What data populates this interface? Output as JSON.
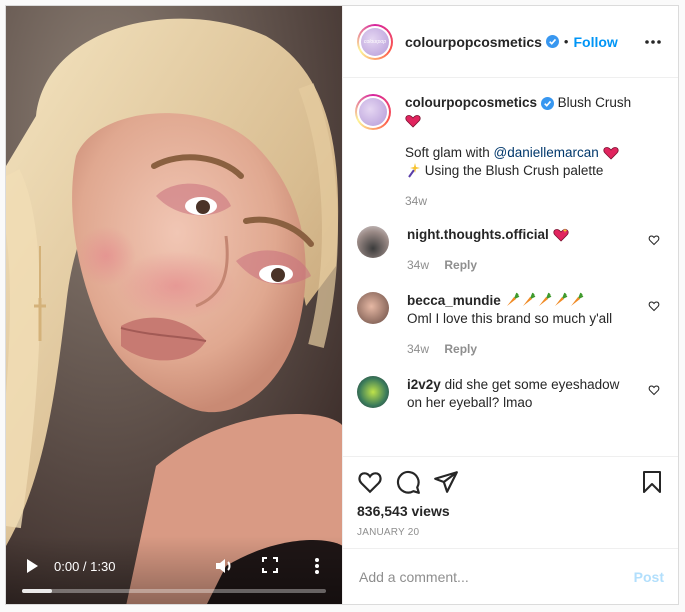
{
  "video": {
    "time_display": "0:00 / 1:30",
    "progress_fraction": 0.1
  },
  "header": {
    "username": "colourpopcosmetics",
    "separator": "•",
    "follow_label": "Follow",
    "avatar_text": "colourpop"
  },
  "caption": {
    "username": "colourpopcosmetics",
    "title": "Blush Crush",
    "line1_prefix": "Soft glam with ",
    "mention": "@daniellemarcan",
    "line2": "Using the Blush Crush palette",
    "age": "34w"
  },
  "comments": [
    {
      "username": "night.thoughts.official",
      "text": "",
      "age": "34w",
      "reply_label": "Reply"
    },
    {
      "username": "becca_mundie",
      "text": "Oml I love this brand so much y'all",
      "age": "34w",
      "reply_label": "Reply"
    },
    {
      "username": "i2v2y",
      "text": "did she get some eyeshadow on her eyeball? lmao",
      "age": "",
      "reply_label": ""
    }
  ],
  "stats": {
    "views": "836,543 views",
    "date": "JANUARY 20"
  },
  "add_comment": {
    "placeholder": "Add a comment...",
    "post_label": "Post"
  },
  "colors": {
    "link_blue": "#0095f6",
    "mention_blue": "#00376b",
    "heart_red": "#ed4956",
    "post_disabled": "#b2dffc"
  },
  "icons": [
    "play-icon",
    "volume-icon",
    "fullscreen-icon",
    "more-vertical-icon",
    "verified-badge-icon",
    "more-horizontal-icon",
    "heart-icon",
    "comment-icon",
    "share-icon",
    "bookmark-icon",
    "carrot-emoji",
    "sparkle-emoji"
  ]
}
